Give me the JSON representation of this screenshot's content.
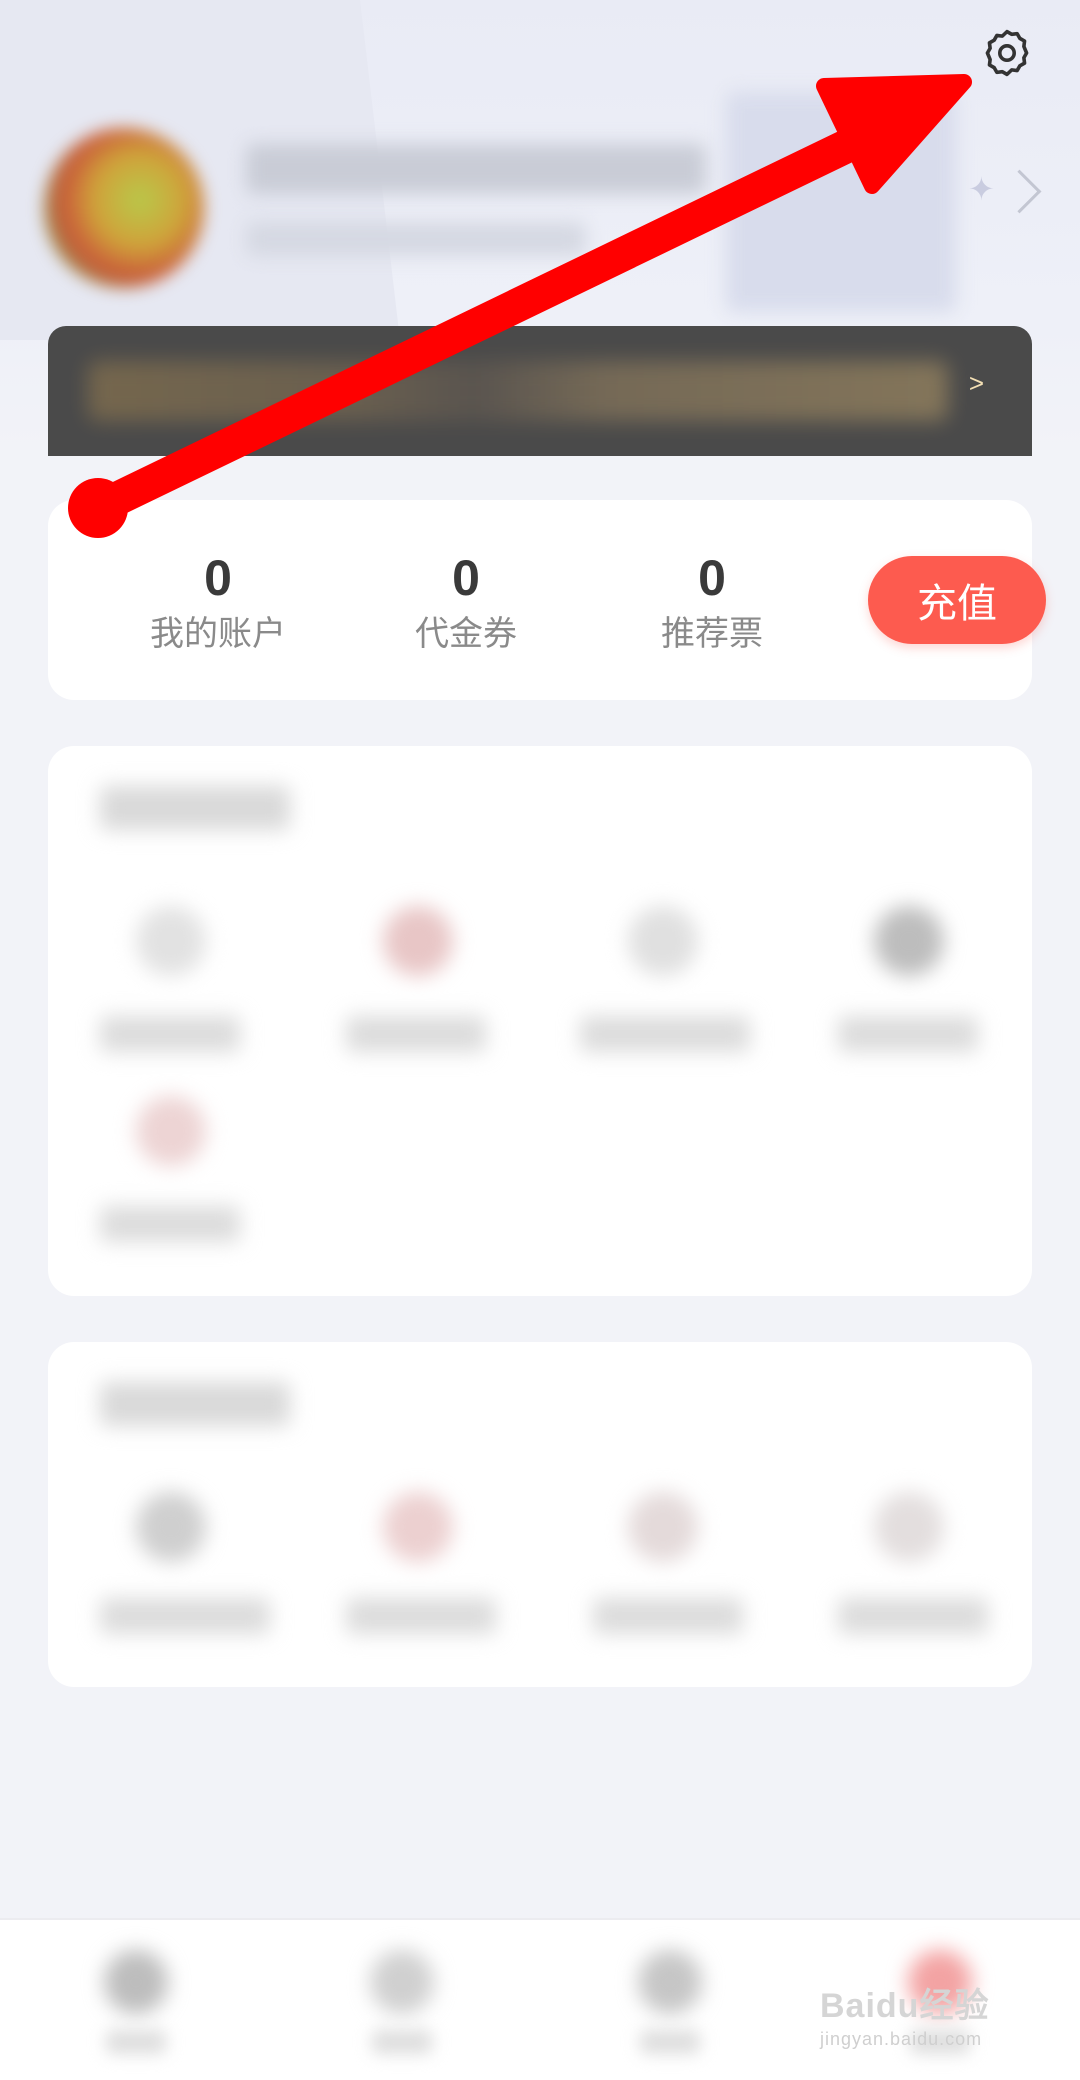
{
  "settings": {
    "icon": "gear-icon"
  },
  "account_stats": [
    {
      "value": "0",
      "label": "我的账户"
    },
    {
      "value": "0",
      "label": "代金券"
    },
    {
      "value": "0",
      "label": "推荐票"
    }
  ],
  "recharge_button": {
    "label": "充值"
  },
  "vip_bar": {
    "arrow": ">"
  },
  "watermark": {
    "brand": "Baidu经验",
    "url": "jingyan.baidu.com"
  },
  "colors": {
    "accent": "#fd5b4f",
    "annotation_arrow": "#ff0000",
    "vip_bar": "#4a4a4a"
  }
}
